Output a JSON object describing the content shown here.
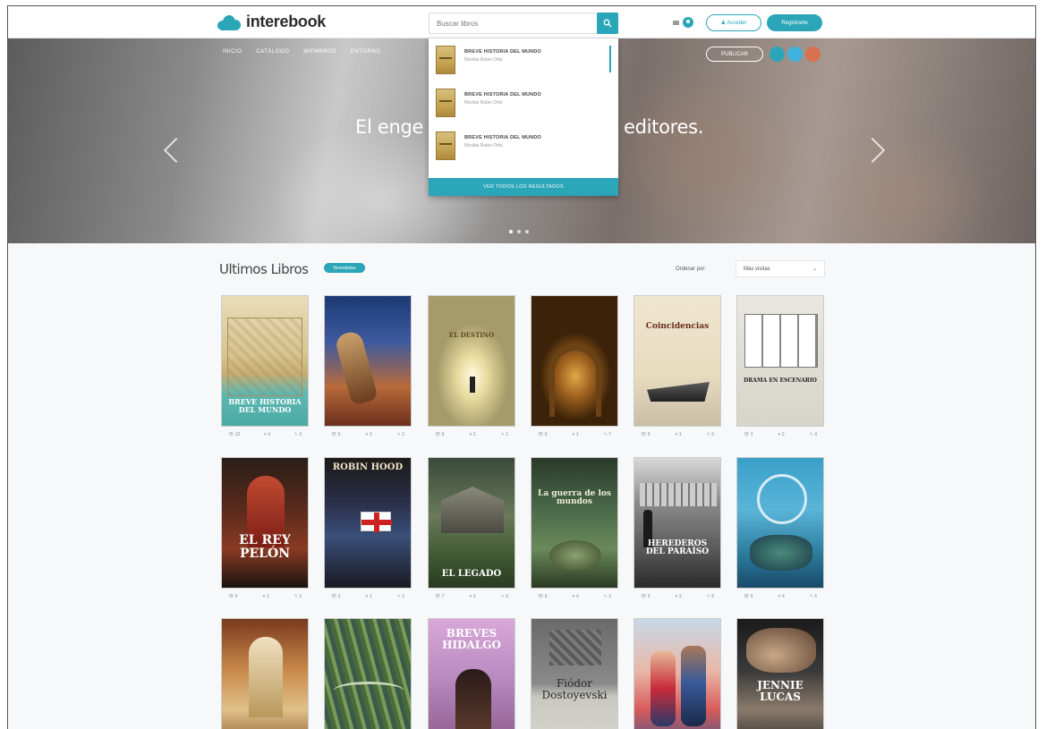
{
  "header": {
    "logo_text": "interebook",
    "search_placeholder": "Buscar libros",
    "btn_outline_label": "♟ Acceder",
    "btn_fill_label": "Registrarte"
  },
  "hero": {
    "nav": [
      "INICIO",
      "CATÁLOGO",
      "MIEMBROS",
      "ENTORNO"
    ],
    "publish_label": "PUBLICAR",
    "text_left": "El enge",
    "text_right": "editores."
  },
  "dropdown": {
    "items": [
      {
        "title": "BREVE HISTORIA DEL MUNDO",
        "author": "Nicolás Rubio Ortiz"
      },
      {
        "title": "BREVE HISTORIA DEL MUNDO",
        "author": "Nicolás Rubio Ortiz"
      },
      {
        "title": "BREVE HISTORIA DEL MUNDO",
        "author": "Nicolás Rubio Ortiz"
      }
    ],
    "footer": "VER TODOS LOS RESULTADOS"
  },
  "section": {
    "title": "Ultimos Libros",
    "badge": "Novedades",
    "order_label": "Ordenar por:",
    "order_value": "Más visitas"
  },
  "books": [
    {
      "cover_title": "BREVE HISTORIA DEL MUNDO",
      "stats": [
        "12",
        "4",
        "3"
      ]
    },
    {
      "cover_title": "",
      "stats": [
        "6",
        "3",
        "2"
      ]
    },
    {
      "cover_title": "EL DESTINO",
      "stats": [
        "8",
        "2",
        "1"
      ]
    },
    {
      "cover_title": "",
      "stats": [
        "5",
        "1",
        "7"
      ]
    },
    {
      "cover_title": "Coincidencias",
      "stats": [
        "9",
        "1",
        "5"
      ]
    },
    {
      "cover_title": "DRAMA EN ESCENARIO",
      "stats": [
        "3",
        "2",
        "4"
      ]
    },
    {
      "cover_title": "EL REY PELÓN",
      "stats": [
        "4",
        "1",
        "3"
      ]
    },
    {
      "cover_title": "ROBIN HOOD",
      "stats": [
        "2",
        "1",
        "3"
      ]
    },
    {
      "cover_title": "EL LEGADO",
      "stats": [
        "7",
        "2",
        "6"
      ]
    },
    {
      "cover_title": "La guerra de los mundos",
      "stats": [
        "6",
        "4",
        "2"
      ]
    },
    {
      "cover_title": "HEREDEROS DEL PARAÍSO",
      "stats": [
        "5",
        "3",
        "8"
      ]
    },
    {
      "cover_title": "",
      "stats": [
        "9",
        "4",
        "5"
      ]
    },
    {
      "cover_title": "",
      "stats": [
        "",
        "",
        ""
      ]
    },
    {
      "cover_title": "",
      "stats": [
        "",
        "",
        ""
      ]
    },
    {
      "cover_title": "BREVES HIDALGO",
      "stats": [
        "",
        "",
        ""
      ]
    },
    {
      "cover_title": "Fiódor Dostoyevski",
      "stats": [
        "",
        "",
        ""
      ]
    },
    {
      "cover_title": "",
      "stats": [
        "",
        "",
        ""
      ]
    },
    {
      "cover_title": "JENNIE LUCAS",
      "stats": [
        "",
        "",
        ""
      ]
    }
  ]
}
